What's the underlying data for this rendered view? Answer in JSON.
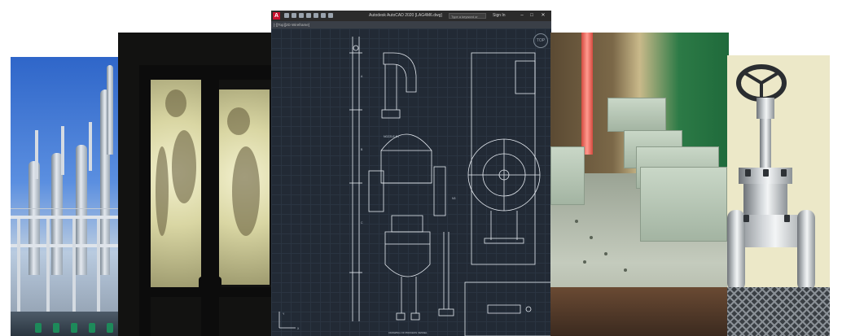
{
  "autocad": {
    "title": "Autodesk AutoCAD 2020   [LAG4M6.dwg]",
    "search_placeholder": "Type a keyword or phrase",
    "sign_in": "Sign In",
    "viewport_label": "[-][Top][2D Wireframe]",
    "nav_label": "TOP",
    "title_block": "DRAWING OF PROCESS VESSEL"
  }
}
